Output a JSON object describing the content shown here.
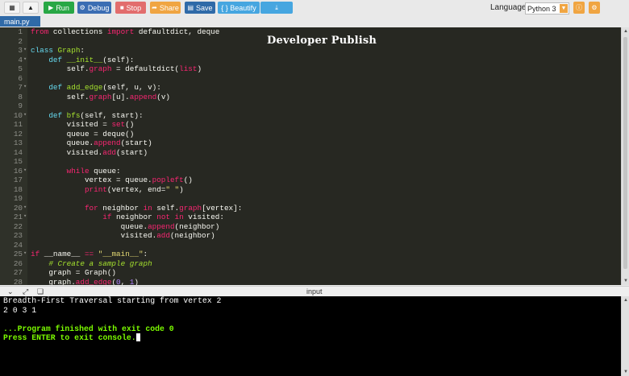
{
  "toolbar": {
    "run_label": "Run",
    "debug_label": "Debug",
    "stop_label": "Stop",
    "share_label": "Share",
    "save_label": "Save",
    "beautify_label": "{ } Beautify",
    "language_label": "Language",
    "language_value": "Python 3"
  },
  "file_tab": "main.py",
  "watermark": "Developer Publish",
  "console_title": "input",
  "code_lines": [
    [
      {
        "t": "from",
        "c": "kw"
      },
      {
        "t": " collections "
      },
      {
        "t": "import",
        "c": "kw"
      },
      {
        "t": " defaultdict, deque"
      }
    ],
    [],
    [
      {
        "t": "class",
        "c": "def"
      },
      {
        "t": " "
      },
      {
        "t": "Graph",
        "c": "fn"
      },
      {
        "t": ":"
      }
    ],
    [
      {
        "t": "    "
      },
      {
        "t": "def",
        "c": "def"
      },
      {
        "t": " "
      },
      {
        "t": "__init__",
        "c": "fn"
      },
      {
        "t": "(self):"
      }
    ],
    [
      {
        "t": "        self."
      },
      {
        "t": "graph",
        "c": "attr"
      },
      {
        "t": " = defaultdict("
      },
      {
        "t": "list",
        "c": "attr"
      },
      {
        "t": ")"
      }
    ],
    [],
    [
      {
        "t": "    "
      },
      {
        "t": "def",
        "c": "def"
      },
      {
        "t": " "
      },
      {
        "t": "add_edge",
        "c": "fn"
      },
      {
        "t": "(self, u, v):"
      }
    ],
    [
      {
        "t": "        self."
      },
      {
        "t": "graph",
        "c": "attr"
      },
      {
        "t": "[u]."
      },
      {
        "t": "append",
        "c": "attr"
      },
      {
        "t": "(v)"
      }
    ],
    [],
    [
      {
        "t": "    "
      },
      {
        "t": "def",
        "c": "def"
      },
      {
        "t": " "
      },
      {
        "t": "bfs",
        "c": "fn"
      },
      {
        "t": "(self, start):"
      }
    ],
    [
      {
        "t": "        visited = "
      },
      {
        "t": "set",
        "c": "attr"
      },
      {
        "t": "()"
      }
    ],
    [
      {
        "t": "        queue = deque()"
      }
    ],
    [
      {
        "t": "        queue."
      },
      {
        "t": "append",
        "c": "attr"
      },
      {
        "t": "(start)"
      }
    ],
    [
      {
        "t": "        visited."
      },
      {
        "t": "add",
        "c": "attr"
      },
      {
        "t": "(start)"
      }
    ],
    [],
    [
      {
        "t": "        "
      },
      {
        "t": "while",
        "c": "kw"
      },
      {
        "t": " queue:"
      }
    ],
    [
      {
        "t": "            vertex = queue."
      },
      {
        "t": "popleft",
        "c": "attr"
      },
      {
        "t": "()"
      }
    ],
    [
      {
        "t": "            "
      },
      {
        "t": "print",
        "c": "attr"
      },
      {
        "t": "(vertex, end="
      },
      {
        "t": "\" \"",
        "c": "str"
      },
      {
        "t": ")"
      }
    ],
    [],
    [
      {
        "t": "            "
      },
      {
        "t": "for",
        "c": "kw"
      },
      {
        "t": " neighbor "
      },
      {
        "t": "in",
        "c": "kw"
      },
      {
        "t": " self."
      },
      {
        "t": "graph",
        "c": "attr"
      },
      {
        "t": "[vertex]:"
      }
    ],
    [
      {
        "t": "                "
      },
      {
        "t": "if",
        "c": "kw"
      },
      {
        "t": " neighbor "
      },
      {
        "t": "not in",
        "c": "kw"
      },
      {
        "t": " visited:"
      }
    ],
    [
      {
        "t": "                    queue."
      },
      {
        "t": "append",
        "c": "attr"
      },
      {
        "t": "(neighbor)"
      }
    ],
    [
      {
        "t": "                    visited."
      },
      {
        "t": "add",
        "c": "attr"
      },
      {
        "t": "(neighbor)"
      }
    ],
    [],
    [
      {
        "t": "if",
        "c": "kw"
      },
      {
        "t": " __name__ "
      },
      {
        "t": "==",
        "c": "kw"
      },
      {
        "t": " "
      },
      {
        "t": "\"__main__\"",
        "c": "str"
      },
      {
        "t": ":"
      }
    ],
    [
      {
        "t": "    "
      },
      {
        "t": "# Create a sample graph",
        "c": "com"
      }
    ],
    [
      {
        "t": "    graph = Graph()"
      }
    ],
    [
      {
        "t": "    graph."
      },
      {
        "t": "add_edge",
        "c": "attr"
      },
      {
        "t": "("
      },
      {
        "t": "0",
        "c": "num"
      },
      {
        "t": ", "
      },
      {
        "t": "1",
        "c": "num"
      },
      {
        "t": ")"
      }
    ]
  ],
  "console_lines": [
    {
      "text": "Breadth-First Traversal starting from vertex 2",
      "style": "normal"
    },
    {
      "text": "2 0 3 1",
      "style": "normal"
    },
    {
      "text": "",
      "style": "normal"
    },
    {
      "text": "...Program finished with exit code 0",
      "style": "green"
    },
    {
      "text": "Press ENTER to exit console.",
      "style": "green",
      "cursor": true
    }
  ]
}
